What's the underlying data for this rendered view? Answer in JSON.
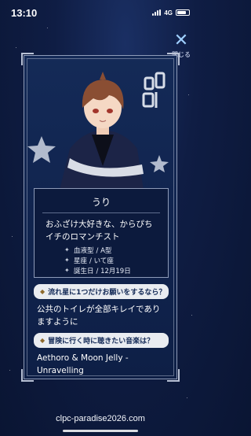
{
  "status": {
    "time": "13:10",
    "network": "4G"
  },
  "close": {
    "label": "閉じる"
  },
  "profile": {
    "name": "うり",
    "tagline": "おふざけ大好きな、からぴちイチのロマンチスト",
    "info": [
      {
        "label": "血液型",
        "value": "/ A型"
      },
      {
        "label": "星座",
        "value": "/ いて座"
      },
      {
        "label": "誕生日",
        "value": "/ 12月19日"
      }
    ]
  },
  "questions": [
    {
      "q": "流れ星に1つだけお願いをするなら？",
      "a": "公共のトイレが全部キレイでありますように"
    },
    {
      "q": "冒険に行く時に聴きたい音楽は？",
      "a": "Aethoro & Moon Jelly - Unravelling"
    }
  ],
  "footer": {
    "url": "clpc-paradise2026.com"
  },
  "colors": {
    "background": "#0f1d44",
    "card": "#142a57",
    "accent": "#8e6a2d",
    "question_bg": "#e9ecf1"
  }
}
